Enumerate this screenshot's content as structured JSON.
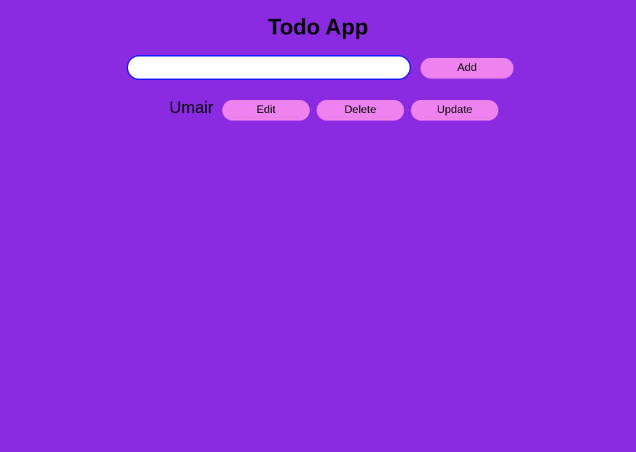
{
  "app": {
    "title": "Todo App"
  },
  "form": {
    "input_value": "",
    "input_placeholder": "",
    "add_label": "Add"
  },
  "todos": [
    {
      "text": "Umair",
      "edit_label": "Edit",
      "delete_label": "Delete",
      "update_label": "Update"
    }
  ],
  "colors": {
    "background": "#8a2be2",
    "button": "#ee82ee",
    "input_border": "#1a1aff"
  }
}
